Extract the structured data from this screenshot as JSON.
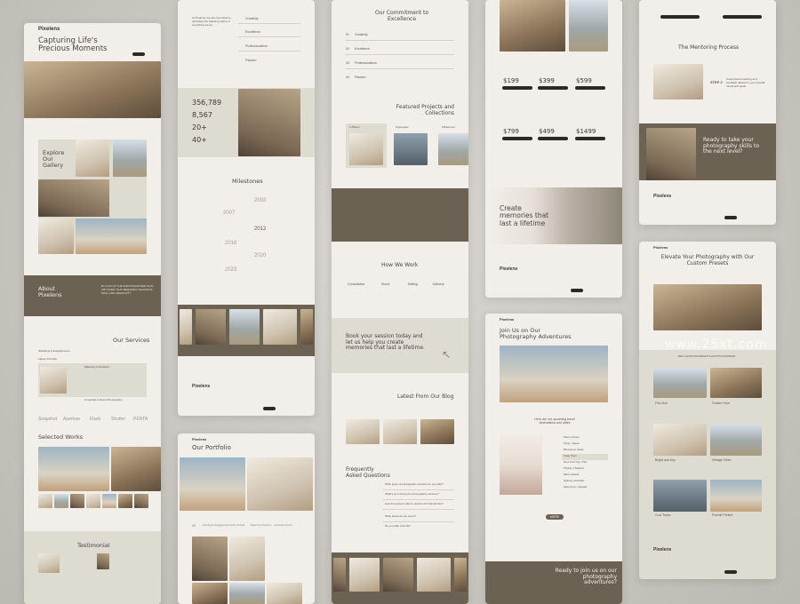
{
  "watermark": "www.25xt.com",
  "brand": "Pixelens",
  "col1": {
    "hero_title": "Capturing Life's Precious Moments",
    "gallery_title": "Explore Our Gallery",
    "about_title": "About Pixelens",
    "about_text": "BY ALSO AT THE PHOTOGRAPHER IS AN ART FORM THAT REQUIRES TECHNICAL SKILL AND CREATIVITY",
    "services_title": "Our Services",
    "services": [
      "Weddings & Engagements",
      "Family Portraits",
      "Maternity & Newborn",
      "Corporate & Event Photography"
    ],
    "partners": [
      "Snapshot",
      "Aperture",
      "Flash",
      "Shutter",
      "PENTA"
    ],
    "works_title": "Selected Works",
    "testimonial_title": "Testimonial"
  },
  "col2": {
    "intro": "At Pixelens, we are committed to upholding the following values in everything we do:",
    "values": [
      "Creativity",
      "Excellence",
      "Professionalism",
      "Passion"
    ],
    "stats": [
      "356,789",
      "8,567",
      "20+",
      "40+"
    ],
    "milestones_title": "Milestones",
    "years": [
      "2003",
      "2007",
      "2012",
      "2016",
      "2020",
      "2023"
    ],
    "portfolio_title": "Our Portfolio",
    "portfolio_tabs": [
      "All",
      "Weddings & Engagements",
      "Family Portraits",
      "Maternity & Newborn",
      "Corporate & Event"
    ]
  },
  "col3": {
    "commitment_title": "Our Commitment to Excellence",
    "commitments": [
      "01",
      "Creativity",
      "02",
      "Excellence",
      "03",
      "Professionalism",
      "04",
      "Passion"
    ],
    "featured_title": "Featured Projects and Collections",
    "collections": [
      "In Bloom",
      "Cityscapes",
      "Wilderness"
    ],
    "work_title": "How We Work",
    "steps": [
      "Consultation",
      "Shoot",
      "Editing",
      "Delivery"
    ],
    "book_cta": "Book your session today and let us help you create memories that last a lifetime.",
    "blog_title": "Latest From Our Blog",
    "faq_title": "Frequently Asked Questions",
    "faqs": [
      "What types of photography services do you offer?",
      "What's your pricing for photography services?",
      "How long does it take to receive the final photos?",
      "What areas do you serve?",
      "Do you offer refunds?"
    ]
  },
  "col4": {
    "prices": [
      "$199",
      "$399",
      "$599",
      "$799",
      "$499",
      "$1499"
    ],
    "hero_text": "Create memories that last a lifetime",
    "join_title": "Join Us on Our Photography Adventures",
    "upcoming": "Here are our upcoming travel destinations and dates",
    "destinations": [
      "Paris, France",
      "Tokyo, Japan",
      "Barcelona, Spain",
      "Cape Town",
      "New York City, USA",
      "Phuket, Thailand",
      "Maui, Hawaii",
      "Sydney, Australia",
      "Vancouver, Canada"
    ],
    "more_btn": "MORE",
    "cta": "Ready to join us on our photography adventures?"
  },
  "col5": {
    "mentoring_title": "The Mentoring Process",
    "step": "STEP 2",
    "step_text": "Customized coaching and feedback tailored to your specific needs and goals.",
    "ready": "Ready to take your photography skills to the next level?",
    "presets_title": "Elevate Your Photography with Our Custom Presets",
    "best_label": "BEST LIGHTROOM PRESETS FOR PHOTOGRAPHERS",
    "presets": [
      "Film Noir",
      "Golden Hour",
      "Bright and Airy",
      "Vintage Vibes",
      "Cool Tones",
      "Portrait Perfect"
    ]
  }
}
